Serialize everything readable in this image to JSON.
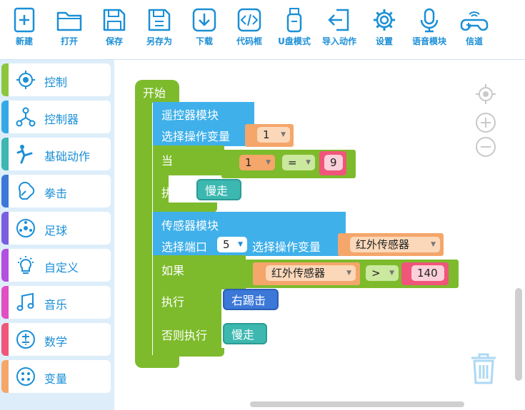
{
  "toolbar": [
    {
      "label": "新建",
      "icon": "new-file-icon"
    },
    {
      "label": "打开",
      "icon": "folder-icon"
    },
    {
      "label": "保存",
      "icon": "save-icon"
    },
    {
      "label": "另存为",
      "icon": "save-as-icon"
    },
    {
      "label": "下载",
      "icon": "download-icon"
    },
    {
      "label": "代码框",
      "icon": "code-icon"
    },
    {
      "label": "U盘模式",
      "icon": "usb-drive-icon"
    },
    {
      "label": "导入动作",
      "icon": "import-icon"
    },
    {
      "label": "设置",
      "icon": "gear-icon"
    },
    {
      "label": "语音模块",
      "icon": "microphone-icon"
    },
    {
      "label": "信道",
      "icon": "gamepad-icon"
    }
  ],
  "categories": [
    {
      "label": "控制",
      "color": "#8cc63f",
      "icon": "target-icon"
    },
    {
      "label": "控制器",
      "color": "#35a9e8",
      "icon": "network-icon"
    },
    {
      "label": "基础动作",
      "color": "#3cb8b0",
      "icon": "kick-figure-icon"
    },
    {
      "label": "拳击",
      "color": "#3b78d8",
      "icon": "boxing-glove-icon"
    },
    {
      "label": "足球",
      "color": "#7a5ee0",
      "icon": "football-icon"
    },
    {
      "label": "自定义",
      "color": "#b54fe0",
      "icon": "lightbulb-icon"
    },
    {
      "label": "音乐",
      "color": "#e04fc4",
      "icon": "music-note-icon"
    },
    {
      "label": "数学",
      "color": "#f0557a",
      "icon": "calculator-icon"
    },
    {
      "label": "变量",
      "color": "#f4a66b",
      "icon": "variable-icon"
    }
  ],
  "blocks": {
    "start": "开始",
    "remote_module": "遥控器模块",
    "select_var": "选择操作变量",
    "remote_var_value": "1",
    "when": "当",
    "cmp_left": "1",
    "cmp_op": "=",
    "cmp_right": "9",
    "execute": "执行",
    "slow_walk": "慢走",
    "sensor_module": "传感器模块",
    "select_port": "选择端口",
    "port_value": "5",
    "select_var2": "选择操作变量",
    "sensor_name": "红外传感器",
    "if_label": "如果",
    "if_left": "红外传感器",
    "if_op": ">",
    "if_right": "140",
    "execute2": "执行",
    "right_kick": "右踢击",
    "else_execute": "否则执行",
    "slow_walk2": "慢走"
  }
}
